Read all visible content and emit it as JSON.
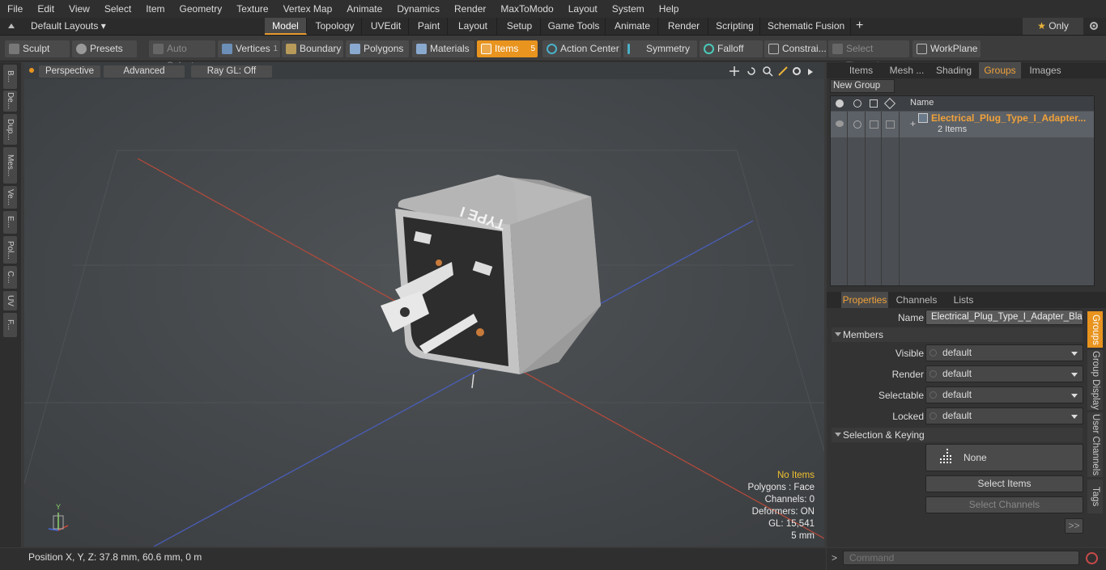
{
  "menu": [
    "File",
    "Edit",
    "View",
    "Select",
    "Item",
    "Geometry",
    "Texture",
    "Vertex Map",
    "Animate",
    "Dynamics",
    "Render",
    "MaxToModo",
    "Layout",
    "System",
    "Help"
  ],
  "layout_selector": "Default Layouts",
  "mode_tabs": [
    "Model",
    "Topology",
    "UVEdit",
    "Paint",
    "Layout",
    "Setup",
    "Game Tools",
    "Animate",
    "Render",
    "Scripting",
    "Schematic Fusion"
  ],
  "only_label": "Only",
  "toolbar": {
    "sculpt": "Sculpt",
    "presets": "Presets",
    "auto_select": "Auto Select",
    "vertices": "Vertices",
    "vertices_count": "1",
    "boundary": "Boundary",
    "polygons": "Polygons",
    "materials": "Materials",
    "items": "Items",
    "items_count": "5",
    "action_center": "Action Center",
    "symmetry": "Symmetry",
    "falloff": "Falloff",
    "constraints": "Constrai...",
    "select_through": "Select Through",
    "workplane": "WorkPlane"
  },
  "left_tabs": [
    "B...",
    "De...",
    "Dup...",
    "Mes...",
    "Ve...",
    "E...",
    "Pol...",
    "C...",
    "UV",
    "F..."
  ],
  "viewport": {
    "perspective": "Perspective",
    "advanced": "Advanced",
    "raygl": "Ray GL: Off",
    "model_label": "TYPE I",
    "info": {
      "no_items": "No Items",
      "polygons": "Polygons : Face",
      "channels": "Channels: 0",
      "deformers": "Deformers: ON",
      "gl": "GL: 15,541",
      "scale": "5 mm"
    },
    "axis_y": "Y"
  },
  "status": {
    "position": "Position X, Y, Z:   37.8 mm, 60.6 mm, 0 m"
  },
  "scene_panel": {
    "tabs": [
      "Items",
      "Mesh ...",
      "Shading",
      "Groups",
      "Images"
    ],
    "active_tab": "Groups",
    "new_group": "New Group",
    "col_name": "Name",
    "group_name": "Electrical_Plug_Type_I_Adapter...",
    "group_count": "2 Items"
  },
  "props_panel": {
    "tabs": [
      "Properties",
      "Channels",
      "Lists"
    ],
    "name_label": "Name",
    "name_value": "Electrical_Plug_Type_I_Adapter_Black",
    "members": "Members",
    "visible_label": "Visible",
    "visible_value": "default",
    "render_label": "Render",
    "render_value": "default",
    "selectable_label": "Selectable",
    "selectable_value": "default",
    "locked_label": "Locked",
    "locked_value": "default",
    "selection_keying": "Selection & Keying",
    "none": "None",
    "select_items": "Select Items",
    "select_channels": "Select Channels",
    "more": ">>",
    "side_tabs": [
      "Groups",
      "Group Display",
      "User Channels",
      "Tags"
    ]
  },
  "command_placeholder": "Command",
  "colors": {
    "accent": "#e8941f",
    "highlight_text": "#f0a13a"
  }
}
